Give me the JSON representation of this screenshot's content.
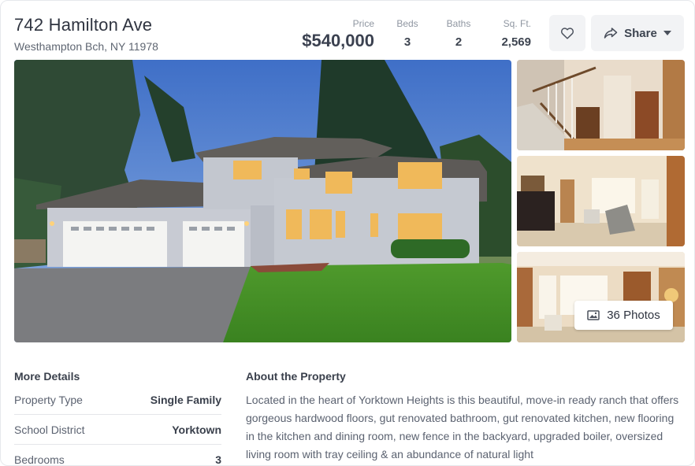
{
  "listing": {
    "street": "742 Hamilton Ave",
    "city_line": "Westhampton Bch, NY 11978"
  },
  "stats": {
    "price_label": "Price",
    "price": "$540,000",
    "beds_label": "Beds",
    "beds": "3",
    "baths_label": "Baths",
    "baths": "2",
    "sqft_label": "Sq. Ft.",
    "sqft": "2,569"
  },
  "actions": {
    "favorite_icon": "heart-icon",
    "share_label": "Share",
    "share_icon": "share-arrow-icon"
  },
  "gallery": {
    "photos_label": "36 Photos",
    "photos_icon": "image-icon"
  },
  "details": {
    "title": "More Details",
    "rows": [
      {
        "label": "Property Type",
        "value": "Single Family"
      },
      {
        "label": "School District",
        "value": "Yorktown"
      },
      {
        "label": "Bedrooms",
        "value": "3"
      }
    ]
  },
  "about": {
    "title": "About the Property",
    "text": "Located in the heart of Yorktown Heights is this beautiful, move-in ready ranch that offers gorgeous hardwood floors, gut renovated bathroom, gut renovated kitchen, new flooring in the kitchen and dining room, new fence in the backyard, upgraded boiler, oversized living room with tray ceiling & an abundance of natural light"
  },
  "colors": {
    "button_bg": "#f2f3f5",
    "text_dark": "#2f3440",
    "text_muted": "#8f96a1"
  }
}
